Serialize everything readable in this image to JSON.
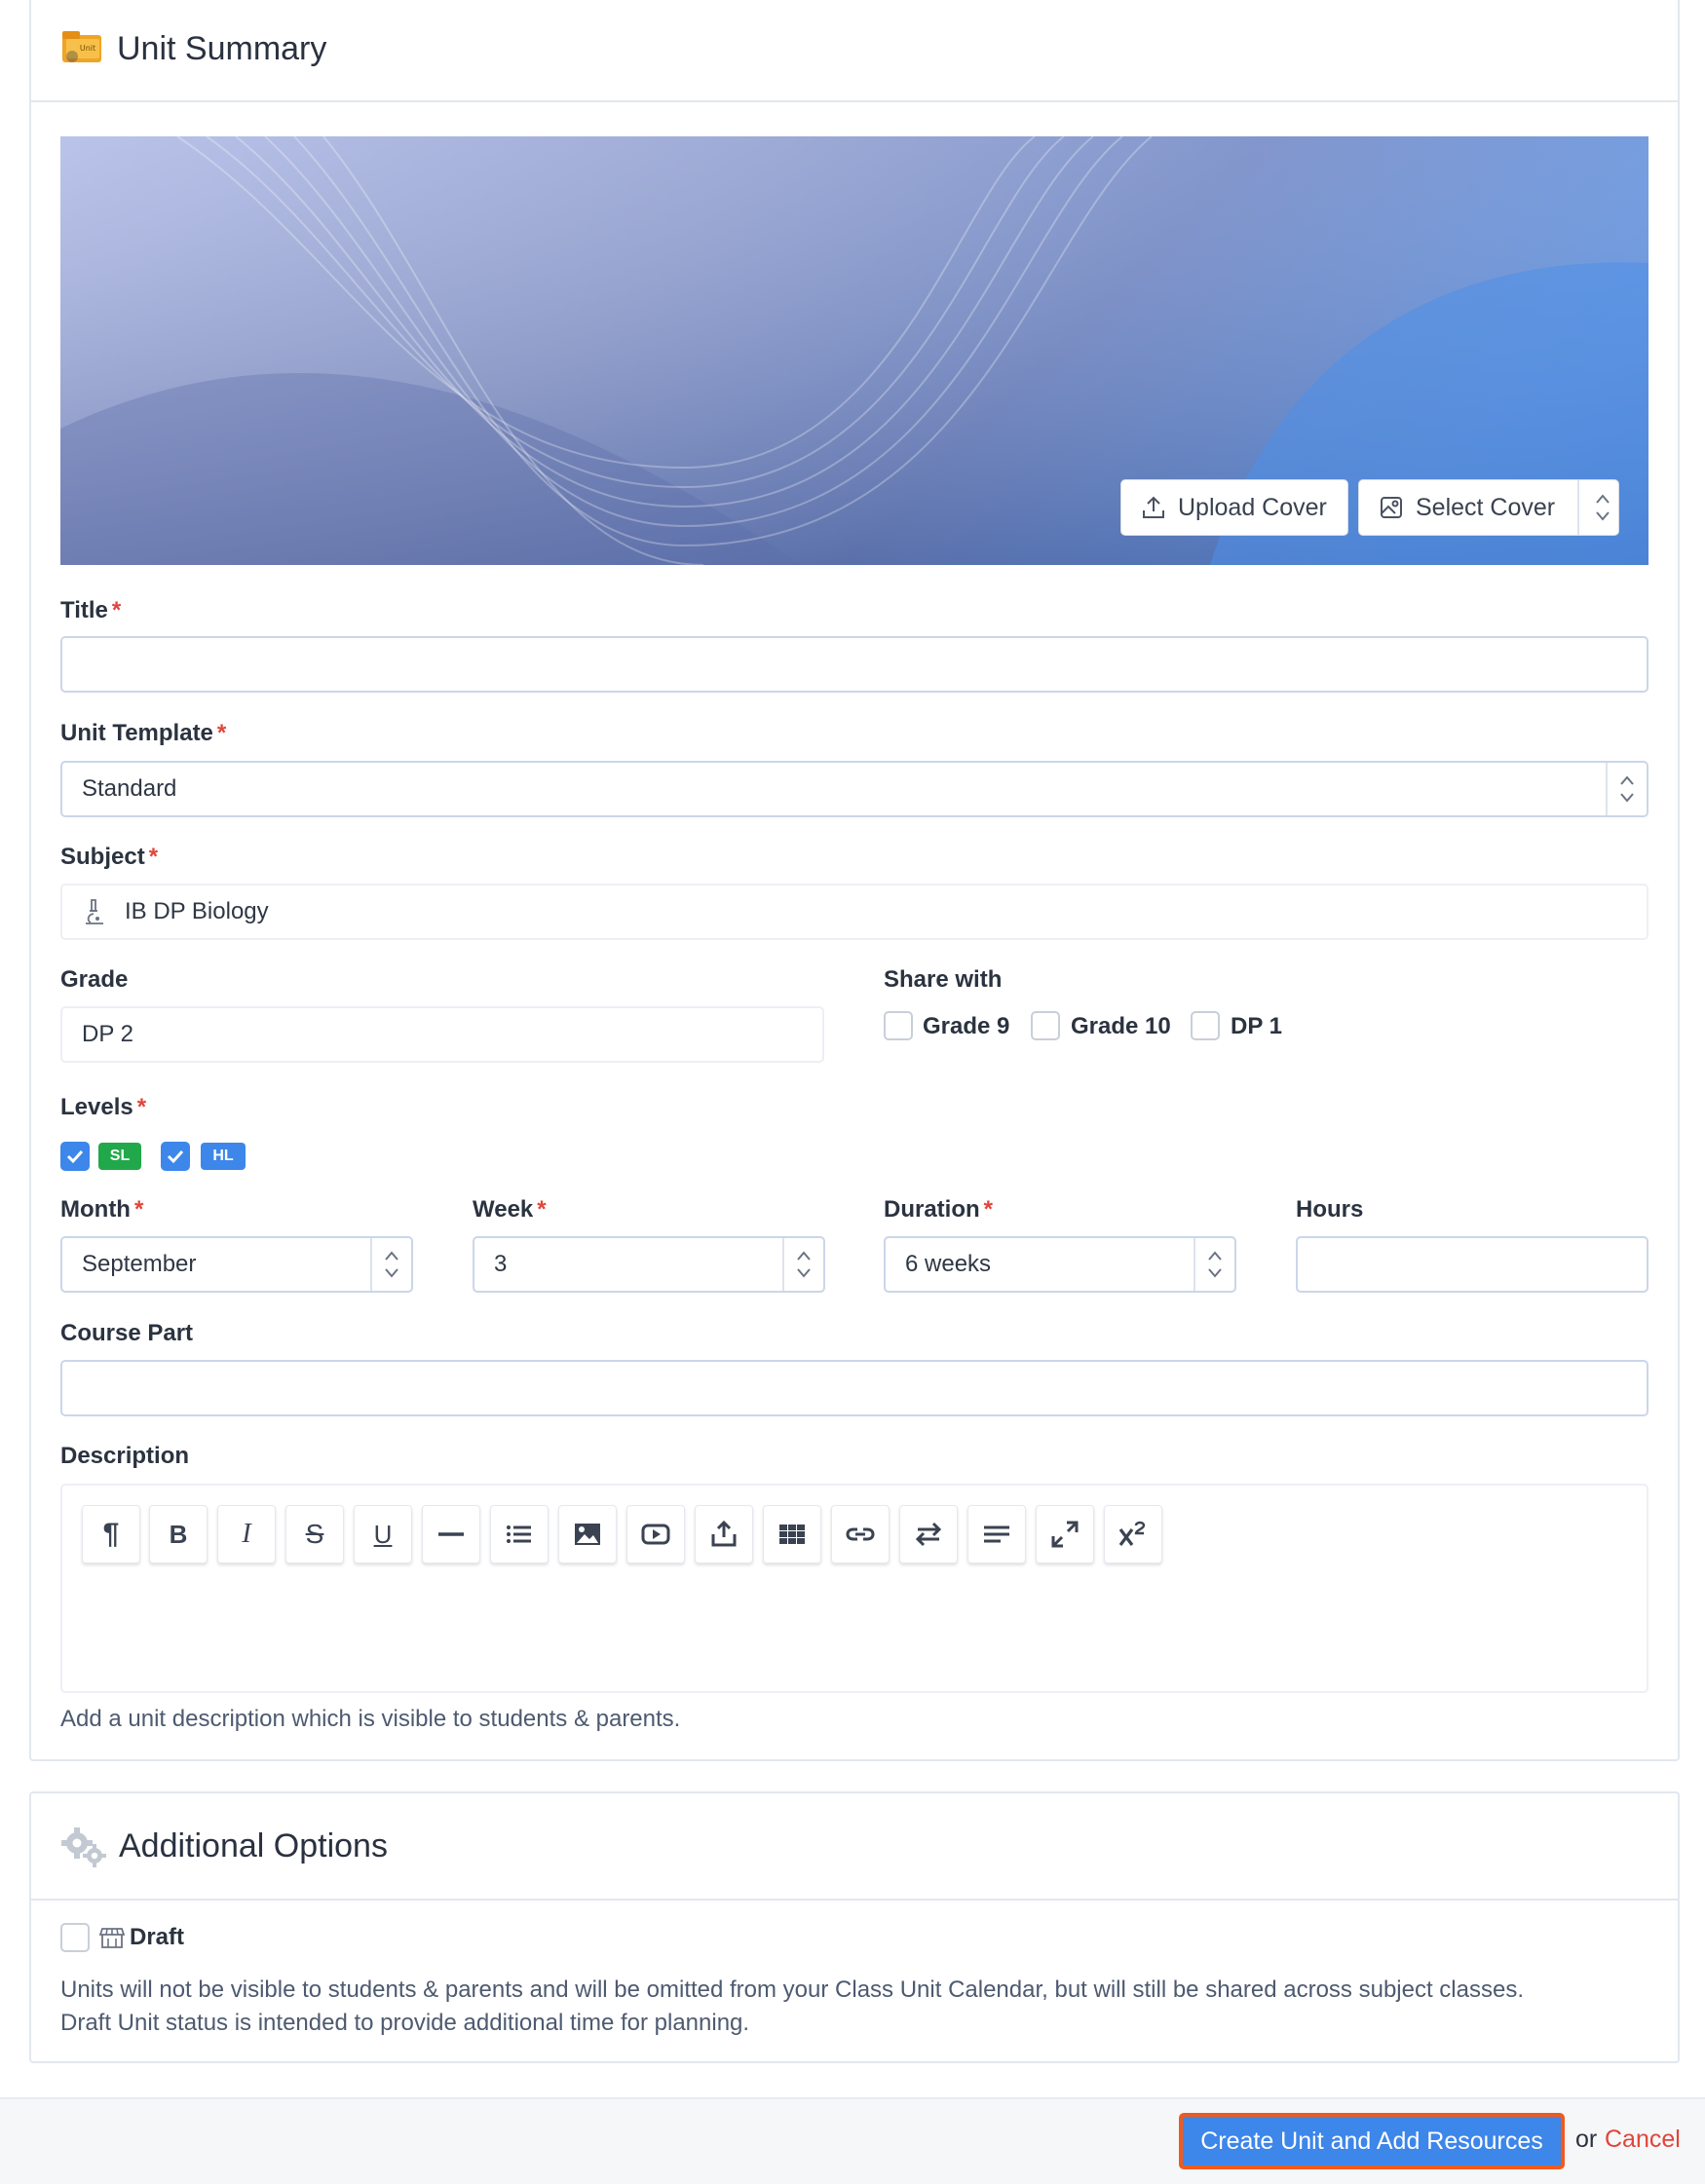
{
  "unit_summary": {
    "header_title": "Unit Summary",
    "cover": {
      "upload_label": "Upload Cover",
      "select_label": "Select Cover"
    },
    "title_field": {
      "label": "Title",
      "value": ""
    },
    "unit_template": {
      "label": "Unit Template",
      "value": "Standard"
    },
    "subject": {
      "label": "Subject",
      "value": "IB DP Biology"
    },
    "grade": {
      "label": "Grade",
      "value": "DP 2"
    },
    "share_with": {
      "label": "Share with",
      "options": [
        {
          "label": "Grade 9",
          "checked": false
        },
        {
          "label": "Grade 10",
          "checked": false
        },
        {
          "label": "DP 1",
          "checked": false
        }
      ]
    },
    "levels": {
      "label": "Levels",
      "items": [
        {
          "label": "SL",
          "checked": true,
          "color": "#21a84a"
        },
        {
          "label": "HL",
          "checked": true,
          "color": "#3d86ea"
        }
      ]
    },
    "month": {
      "label": "Month",
      "value": "September"
    },
    "week": {
      "label": "Week",
      "value": "3"
    },
    "duration": {
      "label": "Duration",
      "value": "6 weeks"
    },
    "hours": {
      "label": "Hours",
      "value": ""
    },
    "course_part": {
      "label": "Course Part",
      "value": ""
    },
    "description": {
      "label": "Description",
      "toolbar": [
        "paragraph-icon",
        "bold-icon",
        "italic-icon",
        "strikethrough-icon",
        "underline-icon",
        "horizontal-rule-icon",
        "list-icon",
        "image-icon",
        "video-icon",
        "upload-icon",
        "table-icon",
        "link-icon",
        "swap-icon",
        "align-icon",
        "fullscreen-icon",
        "superscript-icon"
      ],
      "toolbar_glyphs": {
        "paragraph": "¶",
        "bold": "B",
        "italic": "I",
        "strike": "S",
        "underline": "U"
      },
      "help": "Add a unit description which is visible to students & parents."
    }
  },
  "additional_options": {
    "header_title": "Additional Options",
    "draft": {
      "label": "Draft",
      "checked": false,
      "help_line1": "Units will not be visible to students & parents and will be omitted from your Class Unit Calendar, but will still be shared across subject classes.",
      "help_line2": "Draft Unit status is intended to provide additional time for planning."
    }
  },
  "footer": {
    "submit_label": "Create Unit and Add Resources",
    "or_text": "or",
    "cancel_label": "Cancel"
  },
  "colors": {
    "accent": "#3d86ea",
    "highlight_border": "#f05a1e",
    "required": "#e0453a"
  }
}
